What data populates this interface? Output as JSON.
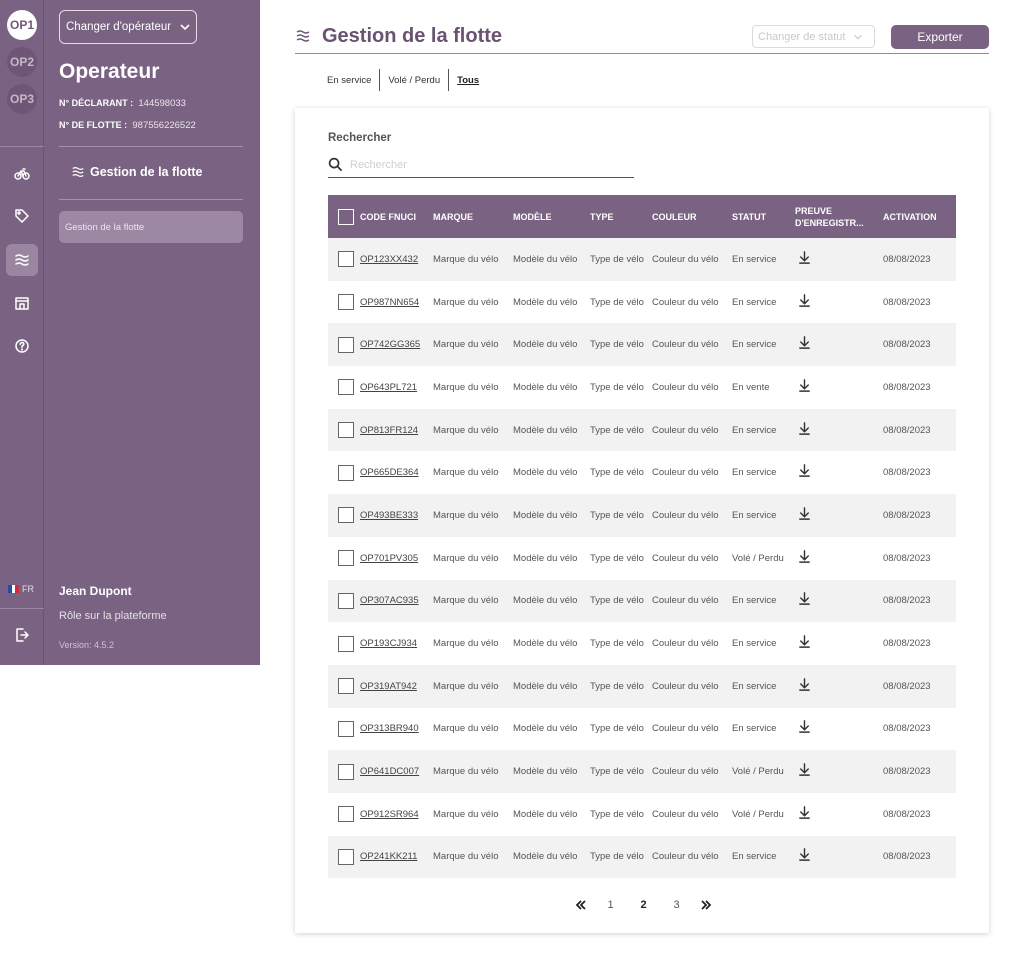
{
  "rail": {
    "operators": [
      "OP1",
      "OP2",
      "OP3"
    ],
    "icons": [
      "bicycle-icon",
      "tag-icon",
      "fleet-icon",
      "store-icon",
      "help-icon"
    ],
    "language": "FR"
  },
  "panel": {
    "operator_select_label": "Changer d'opérateur",
    "operator_name": "Operateur",
    "declarant_label": "N° DÉCLARANT :",
    "declarant_value": "144598033",
    "fleet_label": "N° DE FLOTTE :",
    "fleet_value": "987556226522",
    "section_title": "Gestion de la flotte",
    "nav_item": "Gestion de la flotte",
    "user_name": "Jean Dupont",
    "user_role": "Rôle sur la plateforme",
    "version": "Version: 4.5.2"
  },
  "header": {
    "title": "Gestion de la flotte",
    "status_select_placeholder": "Changer de statut",
    "export_label": "Exporter"
  },
  "filters": [
    {
      "label": "En service",
      "active": false
    },
    {
      "label": "Volé / Perdu",
      "active": false
    },
    {
      "label": "Tous",
      "active": true
    }
  ],
  "search": {
    "label": "Rechercher",
    "placeholder": "Rechercher"
  },
  "table": {
    "columns": [
      "CODE FNUCI",
      "MARQUE",
      "MODÈLE",
      "TYPE",
      "COULEUR",
      "STATUT",
      "PREUVE D'ENREGISTR...",
      "ACTIVATION"
    ],
    "rows": [
      {
        "code": "OP123XX432",
        "marque": "Marque du vélo",
        "modele": "Modèle du vélo",
        "type": "Type de vélo",
        "couleur": "Couleur du vélo",
        "statut": "En service",
        "activation": "08/08/2023"
      },
      {
        "code": "OP987NN654",
        "marque": "Marque du vélo",
        "modele": "Modèle du vélo",
        "type": "Type de vélo",
        "couleur": "Couleur du vélo",
        "statut": "En service",
        "activation": "08/08/2023"
      },
      {
        "code": "OP742GG365",
        "marque": "Marque du vélo",
        "modele": "Modèle du vélo",
        "type": "Type de vélo",
        "couleur": "Couleur du vélo",
        "statut": "En service",
        "activation": "08/08/2023"
      },
      {
        "code": "OP643PL721",
        "marque": "Marque du vélo",
        "modele": "Modèle du vélo",
        "type": "Type de vélo",
        "couleur": "Couleur du vélo",
        "statut": "En vente",
        "activation": "08/08/2023"
      },
      {
        "code": "OP813FR124",
        "marque": "Marque du vélo",
        "modele": "Modèle du vélo",
        "type": "Type de vélo",
        "couleur": "Couleur du vélo",
        "statut": "En service",
        "activation": "08/08/2023"
      },
      {
        "code": "OP665DE364",
        "marque": "Marque du vélo",
        "modele": "Modèle du vélo",
        "type": "Type de vélo",
        "couleur": "Couleur du vélo",
        "statut": "En service",
        "activation": "08/08/2023"
      },
      {
        "code": "OP493BE333",
        "marque": "Marque du vélo",
        "modele": "Modèle du vélo",
        "type": "Type de vélo",
        "couleur": "Couleur du vélo",
        "statut": "En service",
        "activation": "08/08/2023"
      },
      {
        "code": "OP701PV305",
        "marque": "Marque du vélo",
        "modele": "Modèle du vélo",
        "type": "Type de vélo",
        "couleur": "Couleur du vélo",
        "statut": "Volé / Perdu",
        "activation": "08/08/2023"
      },
      {
        "code": "OP307AC935",
        "marque": "Marque du vélo",
        "modele": "Modèle du vélo",
        "type": "Type de vélo",
        "couleur": "Couleur du vélo",
        "statut": "En service",
        "activation": "08/08/2023"
      },
      {
        "code": "OP193CJ934",
        "marque": "Marque du vélo",
        "modele": "Modèle du vélo",
        "type": "Type de vélo",
        "couleur": "Couleur du vélo",
        "statut": "En service",
        "activation": "08/08/2023"
      },
      {
        "code": "OP319AT942",
        "marque": "Marque du vélo",
        "modele": "Modèle du vélo",
        "type": "Type de vélo",
        "couleur": "Couleur du vélo",
        "statut": "En service",
        "activation": "08/08/2023"
      },
      {
        "code": "OP313BR940",
        "marque": "Marque du vélo",
        "modele": "Modèle du vélo",
        "type": "Type de vélo",
        "couleur": "Couleur du vélo",
        "statut": "En service",
        "activation": "08/08/2023"
      },
      {
        "code": "OP641DC007",
        "marque": "Marque du vélo",
        "modele": "Modèle du vélo",
        "type": "Type de vélo",
        "couleur": "Couleur du vélo",
        "statut": "Volé / Perdu",
        "activation": "08/08/2023"
      },
      {
        "code": "OP912SR964",
        "marque": "Marque du vélo",
        "modele": "Modèle du vélo",
        "type": "Type de vélo",
        "couleur": "Couleur du vélo",
        "statut": "Volé / Perdu",
        "activation": "08/08/2023"
      },
      {
        "code": "OP241KK211",
        "marque": "Marque du vélo",
        "modele": "Modèle du vélo",
        "type": "Type de vélo",
        "couleur": "Couleur du vélo",
        "statut": "En service",
        "activation": "08/08/2023"
      }
    ]
  },
  "pagination": {
    "pages": [
      "1",
      "2",
      "3"
    ],
    "current": "2"
  },
  "colors": {
    "primary": "#7a6282",
    "row_alt": "#f2f2f3",
    "title": "#6a5371"
  }
}
